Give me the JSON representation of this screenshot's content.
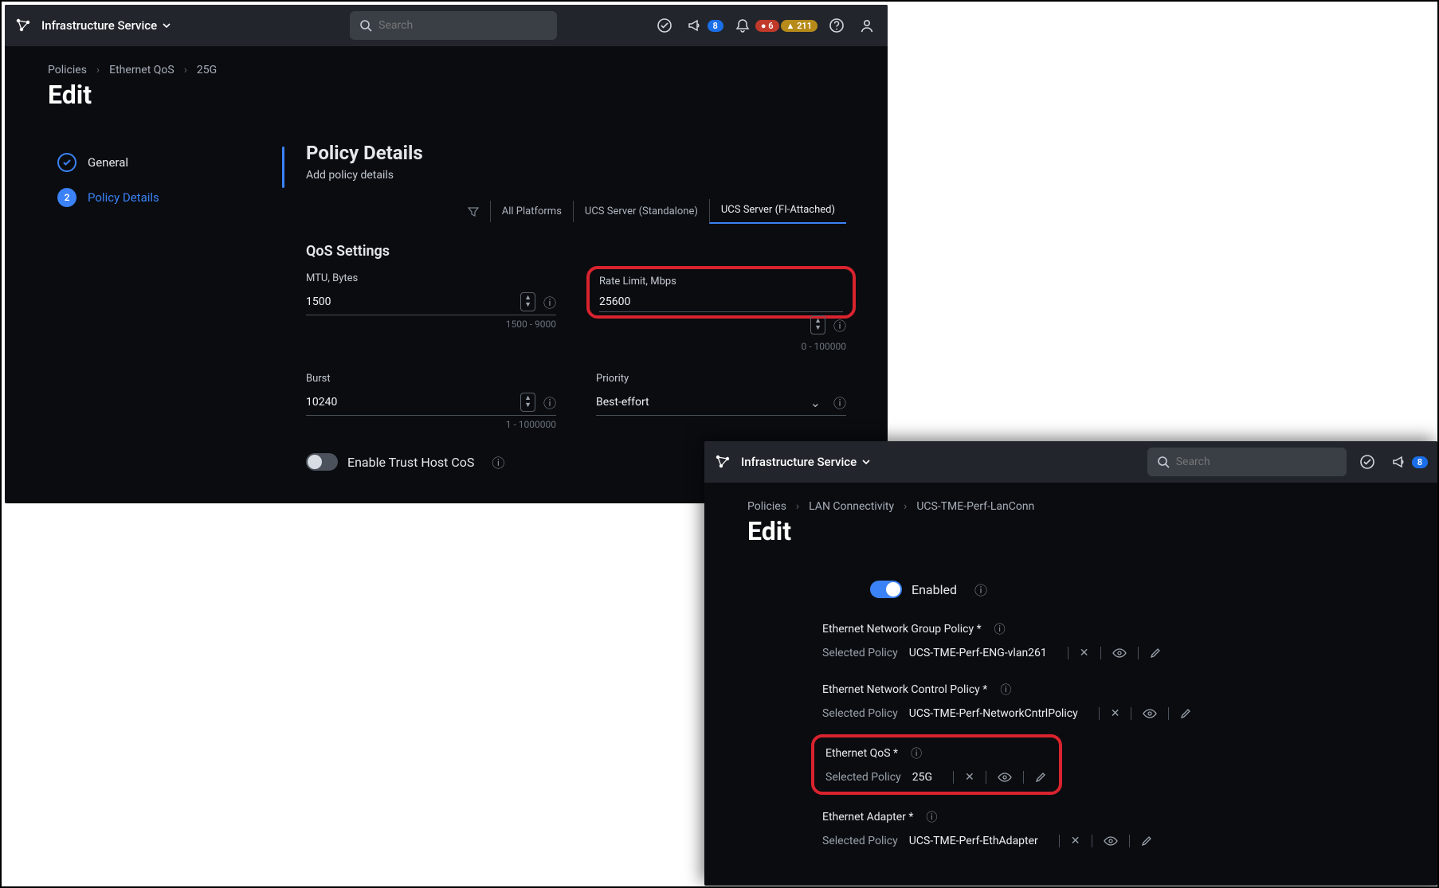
{
  "win1": {
    "service": "Infrastructure Service",
    "search_placeholder": "Search",
    "badges": {
      "announce": "8",
      "alert_red": "6",
      "alert_yel": "211"
    },
    "crumbs": [
      "Policies",
      "Ethernet QoS",
      "25G"
    ],
    "title": "Edit",
    "steps": {
      "general": "General",
      "details": "Policy Details",
      "details_num": "2"
    },
    "main": {
      "heading": "Policy Details",
      "sub": "Add policy details",
      "tabs": {
        "all": "All Platforms",
        "standalone": "UCS Server (Standalone)",
        "fi": "UCS Server (FI-Attached)"
      },
      "section": "QoS Settings",
      "mtu": {
        "label": "MTU, Bytes",
        "value": "1500",
        "range": "1500 - 9000"
      },
      "rate": {
        "label": "Rate Limit, Mbps",
        "value": "25600",
        "range": "0 - 100000"
      },
      "burst": {
        "label": "Burst",
        "value": "10240",
        "range": "1 - 1000000"
      },
      "priority": {
        "label": "Priority",
        "value": "Best-effort"
      },
      "trust": "Enable Trust Host CoS"
    }
  },
  "win2": {
    "service": "Infrastructure Service",
    "search_placeholder": "Search",
    "badges": {
      "announce": "8"
    },
    "crumbs": [
      "Policies",
      "LAN Connectivity",
      "UCS-TME-Perf-LanConn"
    ],
    "title": "Edit",
    "enabled": "Enabled",
    "selected_label": "Selected Policy",
    "policies": {
      "eng": {
        "label": "Ethernet Network Group Policy *",
        "value": "UCS-TME-Perf-ENG-vlan261"
      },
      "ctrl": {
        "label": "Ethernet Network Control Policy *",
        "value": "UCS-TME-Perf-NetworkCntrlPolicy"
      },
      "qos": {
        "label": "Ethernet QoS *",
        "value": "25G"
      },
      "adapter": {
        "label": "Ethernet Adapter *",
        "value": "UCS-TME-Perf-EthAdapter"
      }
    }
  }
}
